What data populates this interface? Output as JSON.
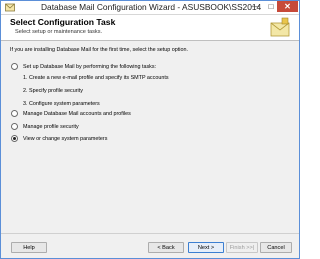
{
  "window": {
    "title": "Database Mail Configuration Wizard - ASUSBOOK\\SS2014",
    "minimize_glyph": "—",
    "maximize_glyph": "□",
    "close_glyph": "✕"
  },
  "header": {
    "title": "Select Configuration Task",
    "subtitle": "Select setup or maintenance tasks."
  },
  "intro": "If you are installing Database Mail for the first time, select the setup option.",
  "options": [
    {
      "label": "Set up Database Mail by performing the following tasks:",
      "selected": false
    },
    {
      "label": "Manage Database Mail accounts and profiles",
      "selected": false
    },
    {
      "label": "Manage profile security",
      "selected": false
    },
    {
      "label": "View or change system parameters",
      "selected": true
    }
  ],
  "setup_steps": [
    "1. Create a new e-mail profile and specify its SMTP accounts",
    "2. Specify profile security",
    "3. Configure system parameters"
  ],
  "buttons": {
    "help": "Help",
    "back": "< Back",
    "next": "Next >",
    "finish": "Finish >>|",
    "cancel": "Cancel"
  },
  "colors": {
    "accent": "#3c7fd1",
    "close": "#c74a3a"
  }
}
